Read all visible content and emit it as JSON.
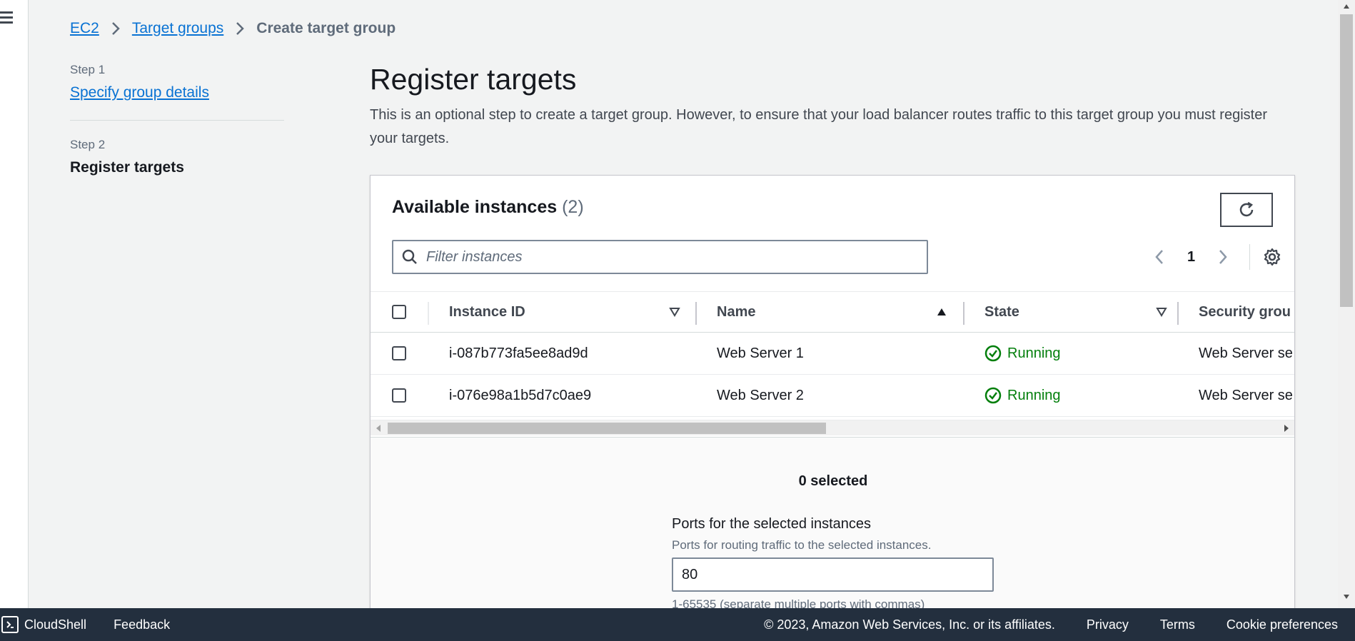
{
  "breadcrumb": {
    "items": [
      "EC2",
      "Target groups"
    ],
    "current": "Create target group"
  },
  "steps": {
    "step1_label": "Step 1",
    "step1_link": "Specify group details",
    "step2_label": "Step 2",
    "step2_title": "Register targets"
  },
  "main": {
    "title": "Register targets",
    "description": "This is an optional step to create a target group. However, to ensure that your load balancer routes traffic to this target group you must register your targets."
  },
  "instances": {
    "title": "Available instances",
    "count": "(2)",
    "filter_placeholder": "Filter instances",
    "page": "1",
    "columns": [
      "Instance ID",
      "Name",
      "State",
      "Security grou"
    ],
    "rows": [
      {
        "id": "i-087b773fa5ee8ad9d",
        "name": "Web Server 1",
        "state": "Running",
        "security": "Web Server se"
      },
      {
        "id": "i-076e98a1b5d7c0ae9",
        "name": "Web Server 2",
        "state": "Running",
        "security": "Web Server se"
      }
    ],
    "selected_text": "0 selected"
  },
  "ports": {
    "label": "Ports for the selected instances",
    "description": "Ports for routing traffic to the selected instances.",
    "value": "80",
    "hint": "1-65535 (separate multiple ports with commas)"
  },
  "footer": {
    "cloudshell": "CloudShell",
    "feedback": "Feedback",
    "copyright": "© 2023, Amazon Web Services, Inc. or its affiliates.",
    "privacy": "Privacy",
    "terms": "Terms",
    "cookies": "Cookie preferences"
  },
  "colors": {
    "link": "#0972d3",
    "success": "#037f0c",
    "footer_bg": "#232f3e"
  }
}
